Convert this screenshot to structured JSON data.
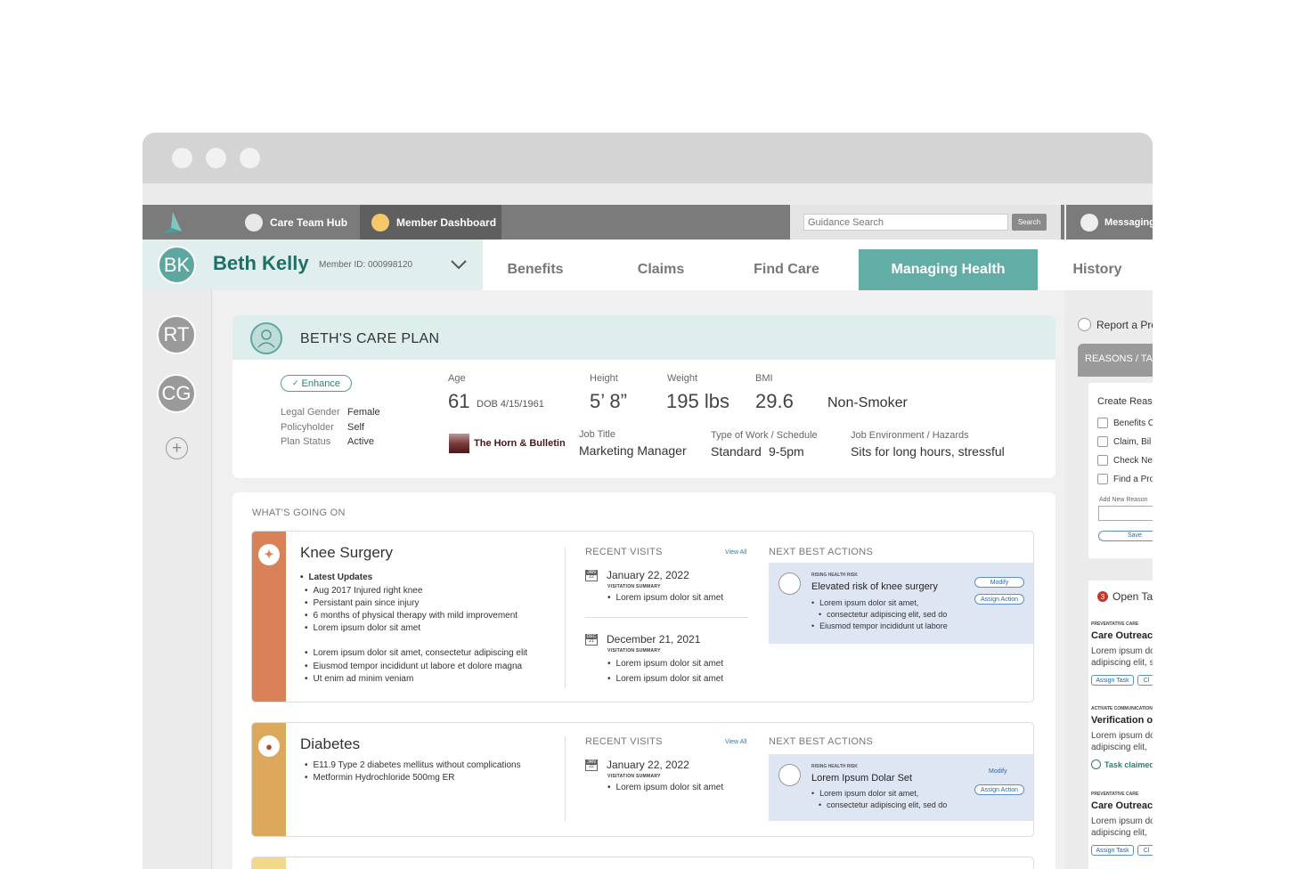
{
  "browser": {
    "dots": 3
  },
  "topnav": {
    "tabs": [
      {
        "label": "Care Team Hub",
        "active": false
      },
      {
        "label": "Member Dashboard",
        "active": true
      }
    ],
    "search": {
      "placeholder": "Guidance Search",
      "button": "Search"
    },
    "messaging": "Messaging"
  },
  "member": {
    "initials": "BK",
    "name": "Beth Kelly",
    "member_id": "Member ID: 000998120"
  },
  "main_tabs": [
    {
      "label": "Benefits",
      "active": false
    },
    {
      "label": "Claims",
      "active": false
    },
    {
      "label": "Find Care",
      "active": false
    },
    {
      "label": "Managing Health",
      "active": true
    },
    {
      "label": "History",
      "active": false
    }
  ],
  "care_team": [
    {
      "initials": "RT"
    },
    {
      "initials": "CG"
    }
  ],
  "care_plan": {
    "title": "BETH'S CARE PLAN",
    "badge": "Enhance",
    "legal_gender_label": "Legal Gender",
    "legal_gender": "Female",
    "policyholder_label": "Policyholder",
    "policyholder": "Self",
    "plan_status_label": "Plan Status",
    "plan_status": "Active",
    "age_label": "Age",
    "age": "61",
    "dob": "DOB 4/15/1961",
    "height_label": "Height",
    "height": "5’ 8”",
    "weight_label": "Weight",
    "weight": "195 lbs",
    "bmi_label": "BMI",
    "bmi": "29.6",
    "smoker": "Non-Smoker",
    "employer": "The Horn & Bulletin",
    "job_title_label": "Job Title",
    "job_title": "Marketing Manager",
    "work_type_label": "Type of Work / Schedule",
    "work_type": "Standard",
    "schedule": "9-5pm",
    "job_env_label": "Job Environment / Hazards",
    "job_env": "Sits for long hours, stressful"
  },
  "whats_going_on": {
    "heading": "WHAT'S GOING ON",
    "recent_visits_label": "RECENT VISITS",
    "view_all": "View All",
    "next_best_actions_label": "NEXT BEST ACTIONS",
    "conditions": [
      {
        "title": "Knee Surgery",
        "color": "#d9825a",
        "updates_label": "Latest Updates",
        "updates": [
          "Aug 2017  Injured right knee",
          "Persistant pain since injury",
          "6 months of physical therapy with mild improvement",
          "Lorem ipsum dolor sit amet"
        ],
        "updates2": [
          "Lorem ipsum dolor sit amet, consectetur adipiscing elit",
          "Eiusmod tempor incididunt ut labore et dolore magna",
          "Ut enim ad minim veniam"
        ],
        "visits": [
          {
            "month": "JAN",
            "day": "22",
            "date": "January 22, 2022",
            "summary_label": "VISITATION SUMMARY",
            "notes": [
              "Lorem ipsum dolor sit amet"
            ]
          },
          {
            "month": "DEC",
            "day": "21",
            "date": "December 21, 2021",
            "summary_label": "VISITATION SUMMARY",
            "notes": [
              "Lorem ipsum dolor sit amet",
              "Lorem ipsum dolor sit amet"
            ]
          }
        ],
        "action": {
          "tag": "RISING HEALTH RISK",
          "title": "Elevated risk of knee surgery",
          "notes": [
            "Lorem ipsum dolor sit amet,",
            "consectetur adipiscing elit, sed do",
            "Eiusmod tempor incididunt ut labore"
          ],
          "modify": "Modify",
          "assign": "Assign Action"
        }
      },
      {
        "title": "Diabetes",
        "color": "#dca85b",
        "notes": [
          "E11.9  Type 2 diabetes mellitus without complications",
          "Metformin Hydrochloride 500mg ER"
        ],
        "visits": [
          {
            "month": "JAN",
            "day": "22",
            "date": "January 22, 2022",
            "summary_label": "VISITATION SUMMARY",
            "notes": [
              "Lorem ipsum dolor sit amet"
            ]
          }
        ],
        "action": {
          "tag": "RISING HEALTH RISK",
          "title": "Lorem Ipsum Dolar Set",
          "notes": [
            "Lorem ipsum dolor sit amet,",
            "consectetur adipiscing elit, sed do"
          ],
          "modify": "Modify",
          "assign": "Assign Action"
        }
      }
    ]
  },
  "right_panel": {
    "report": "Report a Prob",
    "reasons_header": "REASONS / TASKS",
    "create_title": "Create Reason",
    "checkboxes": [
      "Benefits C",
      "Claim, Bil",
      "Check Ne",
      "Find a Pro"
    ],
    "add_new": "Add New Reason",
    "save": "Save",
    "open_tasks_count": "3",
    "open_tasks_label": "Open Tasks",
    "tasks": [
      {
        "tag": "PREVENTATIVE CARE",
        "title": "Care Outreach",
        "body": [
          "Lorem ipsum do",
          "adipiscing elit, s"
        ],
        "button": "Assign Task",
        "button2": "Cl"
      },
      {
        "tag": "ACTIVATE COMMUNICATION",
        "title": "Verification of",
        "body": [
          "Lorem ipsum do",
          "adipiscing elit,"
        ],
        "status": "Task claimed"
      },
      {
        "tag": "PREVENTATIVE CARE",
        "title": "Care Outreach",
        "body": [
          "Lorem ipsum do",
          "adipiscing elit,"
        ],
        "button": "Assign Task",
        "button2": "Cl"
      }
    ]
  },
  "colors": {
    "teal": "#62aea6",
    "accent_dark": "#1f6f67",
    "knee": "#d9825a",
    "diabetes": "#dca85b"
  }
}
